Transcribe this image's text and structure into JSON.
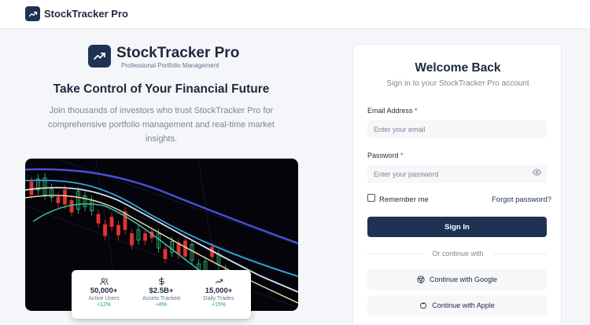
{
  "header": {
    "app_name": "StockTracker Pro",
    "logo_icon": "trending-up-icon"
  },
  "hero": {
    "brand": "StockTracker Pro",
    "tagline": "Professional Portfolio Management",
    "heading": "Take Control of Your Financial Future",
    "description": "Join thousands of investors who trust StockTracker Pro for comprehensive portfolio management and real-time market insights."
  },
  "stats": [
    {
      "icon": "users-icon",
      "value": "50,000+",
      "label": "Active Users",
      "change": "+12%"
    },
    {
      "icon": "dollar-icon",
      "value": "$2.5B+",
      "label": "Assets Tracked",
      "change": "+8%"
    },
    {
      "icon": "trending-up-icon",
      "value": "15,000+",
      "label": "Daily Trades",
      "change": "+15%"
    }
  ],
  "login": {
    "title": "Welcome Back",
    "subtitle": "Sign in to your StockTracker Pro account",
    "email_label": "Email Address",
    "email_placeholder": "Enter your email",
    "password_label": "Password",
    "password_placeholder": "Enter your password",
    "required_marker": "*",
    "remember_label": "Remember me",
    "remember_checked": false,
    "forgot_label": "Forgot password?",
    "signin_label": "Sign In",
    "divider_text": "Or continue with",
    "google_label": "Continue with Google",
    "apple_label": "Continue with Apple"
  },
  "colors": {
    "brand": "#1e3354",
    "positive": "#22a35a",
    "required": "#dc2626",
    "candle_up": "#38c172",
    "candle_down": "#e3342f"
  }
}
